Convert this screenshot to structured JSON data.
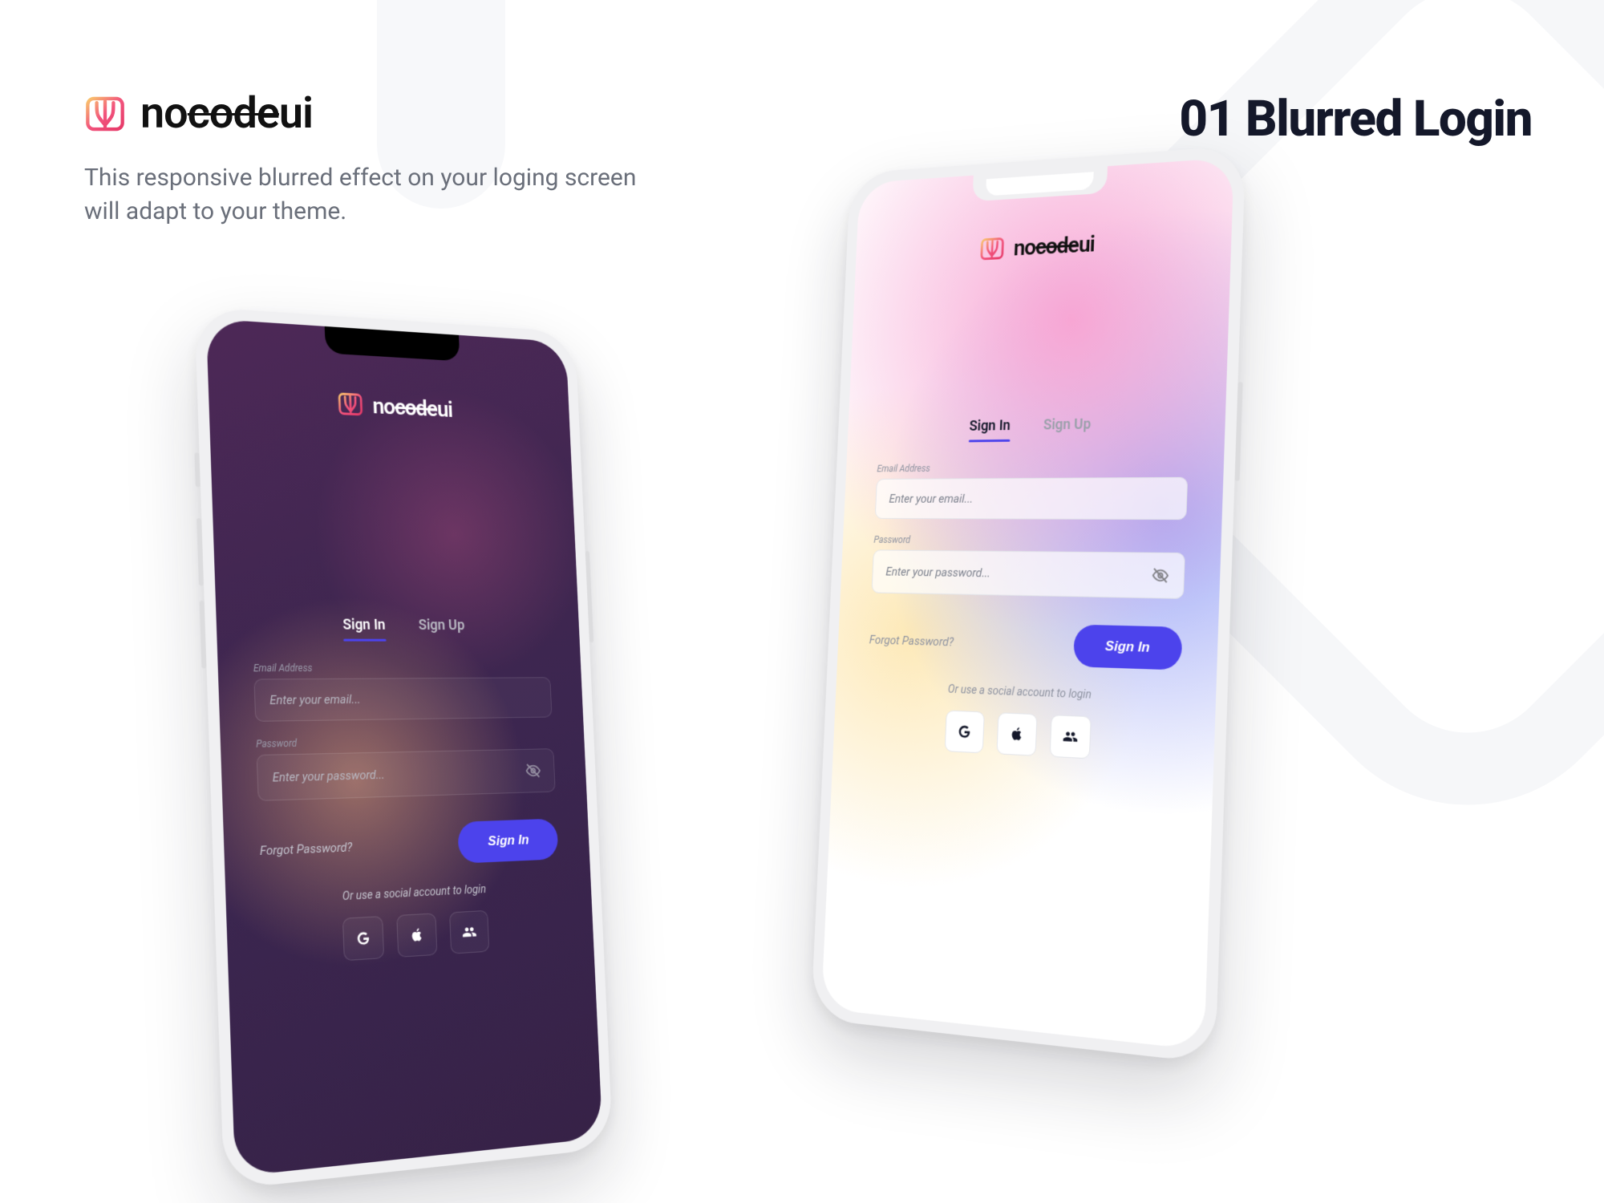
{
  "brand": {
    "prefix": "no",
    "strike": "code",
    "suffix": "ui"
  },
  "description": "This responsive blurred effect on your loging screen will adapt to your theme.",
  "page_title": "01 Blurred Login",
  "tabs": {
    "sign_in": "Sign In",
    "sign_up": "Sign Up"
  },
  "fields": {
    "email_label": "Email Address",
    "email_placeholder": "Enter your email...",
    "password_label": "Password",
    "password_placeholder": "Enter your password..."
  },
  "actions": {
    "forgot": "Forgot Password?",
    "sign_in": "Sign In",
    "or_text": "Or use a social account to login"
  },
  "colors": {
    "accent": "#4c43ec"
  }
}
